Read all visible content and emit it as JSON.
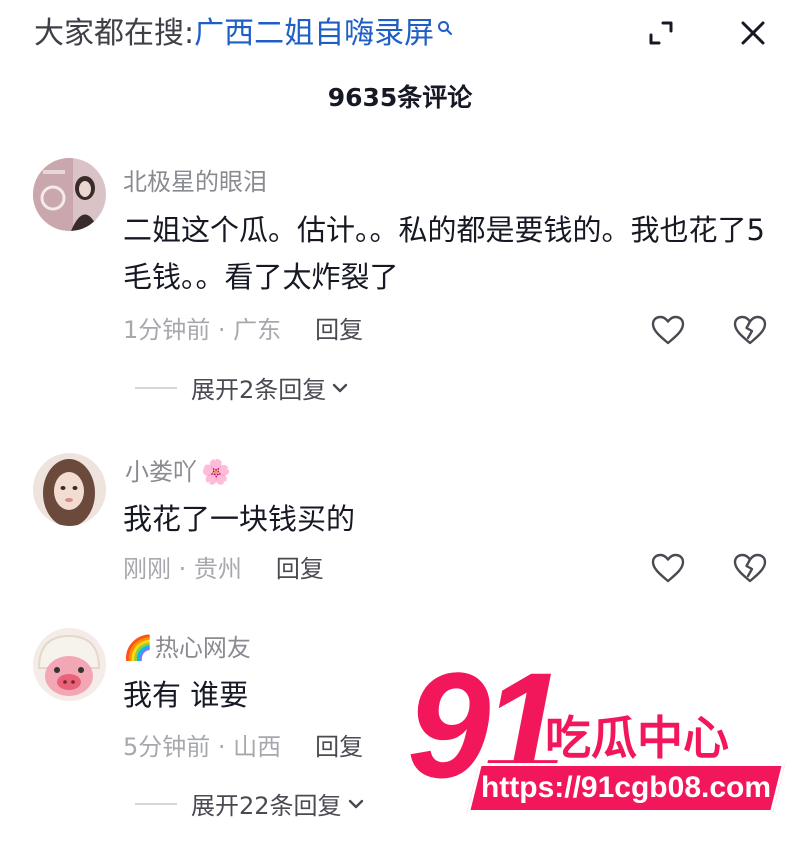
{
  "header": {
    "search_prefix": "大家都在搜:",
    "search_term": "广西二姐自嗨录屏",
    "icons": {
      "search_mini": "search-icon",
      "expand": "expand-icon",
      "close": "close-icon"
    }
  },
  "comment_count_title": "9635条评论",
  "comments": [
    {
      "username": "北极星的眼泪",
      "username_prefix_emoji": "",
      "username_suffix_emoji": "",
      "text": "二姐这个瓜。估计。。私的都是要钱的。我也花了5毛钱。。看了太炸裂了",
      "time_location": "1分钟前 · 广东",
      "reply_label": "回复",
      "expand_label": "展开2条回复"
    },
    {
      "username": "小娄吖",
      "username_prefix_emoji": "",
      "username_suffix_emoji": "🌸",
      "text": "我花了一块钱买的",
      "time_location": "刚刚 · 贵州",
      "reply_label": "回复",
      "expand_label": ""
    },
    {
      "username": "热心网友",
      "username_prefix_emoji": "🌈",
      "username_suffix_emoji": "",
      "text": "我有 谁要",
      "time_location": "5分钟前 · 山西",
      "reply_label": "回复",
      "expand_label": "展开22条回复"
    }
  ],
  "watermark": {
    "number": "91",
    "name": "吃瓜中心",
    "url": "https://91cgb08.com"
  },
  "colors": {
    "search_link": "#1f5fc4",
    "watermark": "#f2175b",
    "secondary_text": "#8a8b91"
  }
}
